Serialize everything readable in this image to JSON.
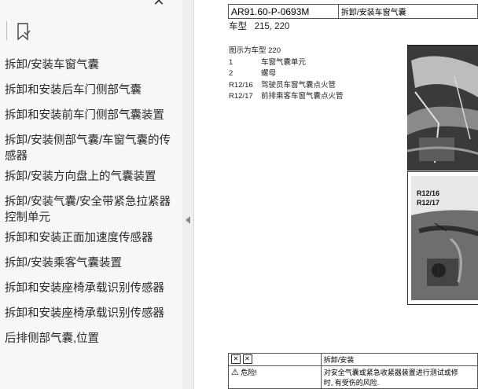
{
  "sidebar": {
    "items": [
      {
        "label": "拆卸/安装车窗气囊"
      },
      {
        "label": "拆卸和安装后车门侧部气囊"
      },
      {
        "label": "拆卸和安装前车门侧部气囊装置"
      },
      {
        "label": "拆卸/安装侧部气囊/车窗气囊的传感器"
      },
      {
        "label": "拆卸/安装方向盘上的气囊装置"
      },
      {
        "label": "拆卸/安装气囊/安全带紧急拉紧器控制单元"
      },
      {
        "label": "拆卸和安装正面加速度传感器"
      },
      {
        "label": "拆卸/安装乘客气囊装置"
      },
      {
        "label": "拆卸和安装座椅承载识别传感器"
      },
      {
        "label": "拆卸和安装座椅承载识别传感器"
      },
      {
        "label": "后排侧部气囊,位置"
      }
    ]
  },
  "doc": {
    "doc_code": "AR91.60-P-0693M",
    "doc_title": "拆卸/安装车窗气囊",
    "model_label": "车型",
    "model_value": "215, 220",
    "figure_caption": "图示为车型 220",
    "legend": [
      {
        "key": "1",
        "text": "车窗气囊单元"
      },
      {
        "key": "2",
        "text": "螺母"
      },
      {
        "key": "R12/16",
        "text": "驾驶员车窗气囊点火管"
      },
      {
        "key": "R12/17",
        "text": "前排乘客车窗气囊点火管"
      }
    ],
    "figure_labels": [
      "R12/16",
      "R12/17"
    ],
    "table": {
      "header_right": "拆卸/安装",
      "danger_label": "危险!",
      "danger_text_1": "对安全气囊或紧急收紧器装置进行测试或修",
      "danger_text_2": "时, 有受伤的风险."
    }
  }
}
